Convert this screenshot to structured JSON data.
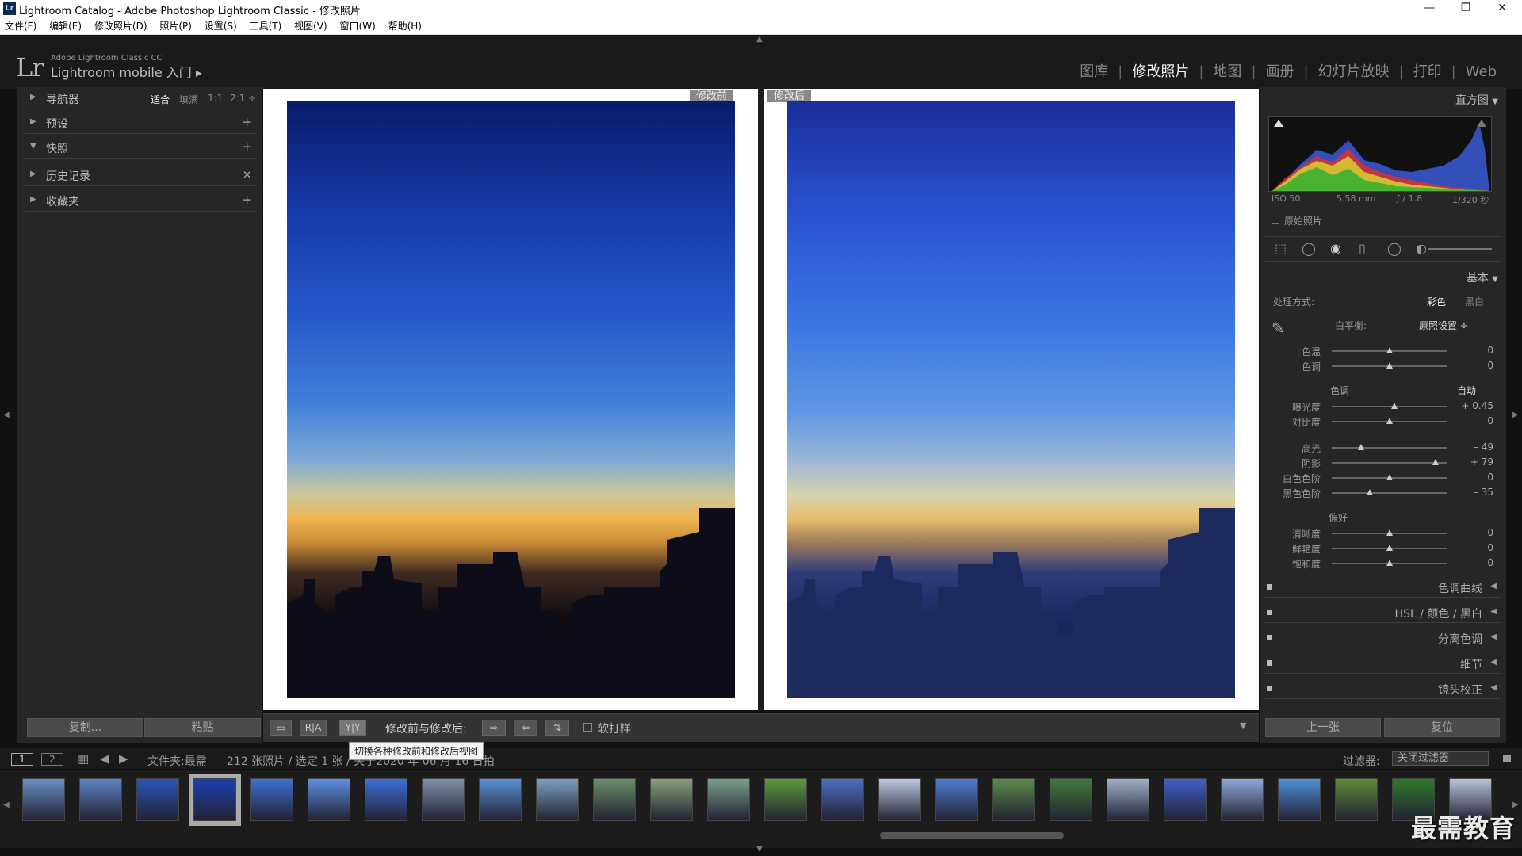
{
  "window": {
    "title": "Lightroom Catalog - Adobe Photoshop Lightroom Classic - 修改照片",
    "badge": "Lr",
    "minimize": "—",
    "restore": "❐",
    "close": "✕"
  },
  "menu": [
    "文件(F)",
    "编辑(E)",
    "修改照片(D)",
    "照片(P)",
    "设置(S)",
    "工具(T)",
    "视图(V)",
    "窗口(W)",
    "帮助(H)"
  ],
  "brand": {
    "logo": "Lr",
    "top": "Adobe Lightroom Classic CC",
    "main": "Lightroom mobile 入门 ▸"
  },
  "modules": [
    "图库",
    "修改照片",
    "地图",
    "画册",
    "幻灯片放映",
    "打印",
    "Web"
  ],
  "left_panel": {
    "navigator": "导航器",
    "zoom": [
      "适合",
      "填满",
      "1:1",
      "2:1 ÷"
    ],
    "sections": [
      {
        "label": "预设",
        "action": "+"
      },
      {
        "label": "快照",
        "action": "+"
      },
      {
        "label": "历史记录",
        "action": "×"
      },
      {
        "label": "收藏夹",
        "action": "+"
      }
    ],
    "copy": "复制...",
    "paste": "粘贴"
  },
  "view": {
    "before_label": "修改前",
    "after_label": "修改后"
  },
  "toolbar": {
    "yy": "Y|Y",
    "ra": "R|A",
    "label": "修改前与修改后:",
    "soft_proof": "软打样",
    "tooltip": "切换各种修改前和修改后视图"
  },
  "right_panel": {
    "histogram": "直方图",
    "exif": [
      "ISO 50",
      "5.58 mm",
      "ƒ / 1.8",
      "1/320 秒"
    ],
    "original": "原始照片",
    "basic": "基本",
    "treatment": "处理方式:",
    "color": "彩色",
    "bw": "黑白",
    "wb_label": "白平衡:",
    "wb_value": "原照设置 ÷",
    "tone": "色调",
    "auto": "自动",
    "presence": "偏好",
    "sliders_wb": [
      {
        "label": "色温",
        "value": "0",
        "pos": 0.5
      },
      {
        "label": "色调",
        "value": "0",
        "pos": 0.5
      }
    ],
    "sliders_tone1": [
      {
        "label": "曝光度",
        "value": "+ 0.45",
        "pos": 0.54
      },
      {
        "label": "对比度",
        "value": "0",
        "pos": 0.5
      }
    ],
    "sliders_tone2": [
      {
        "label": "高光",
        "value": "– 49",
        "pos": 0.25
      },
      {
        "label": "阴影",
        "value": "+ 79",
        "pos": 0.9
      },
      {
        "label": "白色色阶",
        "value": "0",
        "pos": 0.5
      },
      {
        "label": "黑色色阶",
        "value": "– 35",
        "pos": 0.33
      }
    ],
    "sliders_presence": [
      {
        "label": "清晰度",
        "value": "0",
        "pos": 0.5
      },
      {
        "label": "鲜艳度",
        "value": "0",
        "pos": 0.5
      },
      {
        "label": "饱和度",
        "value": "0",
        "pos": 0.5
      }
    ],
    "collapsed": [
      "色调曲线",
      "HSL / 颜色 / 黑白",
      "分离色调",
      "细节",
      "镜头校正"
    ],
    "prev": "上一张",
    "reset": "复位"
  },
  "status": {
    "page1": "1",
    "page2": "2",
    "folder": "文件夹:最需",
    "count": "212 张照片 / 选定 1 张 / 关于2020 年 06 月 16 日拍",
    "filter_label": "过滤器:",
    "filter_value": "关闭过滤器"
  },
  "watermark": "最需教育",
  "filmstrip_colors": [
    "#6b8fc4",
    "#5d84c2",
    "#2a56b8",
    "#1c3fae",
    "#3f6fcf",
    "#5d8ee0",
    "#3d6ed7",
    "#7b8fa8",
    "#5b8fd0",
    "#7aa0c0",
    "#6b8f6a",
    "#87a07a",
    "#7aa08a",
    "#5d9a3a",
    "#4d6fc2",
    "#b9c8e0",
    "#4f7fd0",
    "#5b8a4a",
    "#3f7a3a",
    "#9fb0c8",
    "#4060c8",
    "#8fa8d8",
    "#4f8fd8",
    "#5f8a3a",
    "#2f7a2a",
    "#b8c4d8"
  ]
}
